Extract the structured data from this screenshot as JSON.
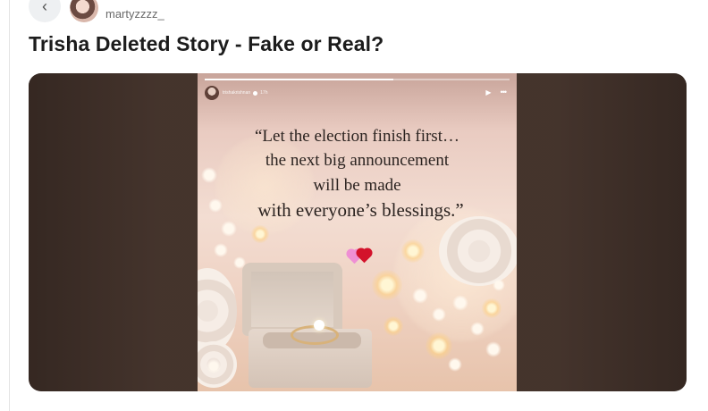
{
  "header": {
    "back_icon": "chevron-left-icon",
    "username": "martyzzzz_"
  },
  "post": {
    "title": "Trisha Deleted Story - Fake or Real?"
  },
  "story": {
    "progress": 0.62,
    "user_handle": "trishakrishnan",
    "time": "17h",
    "quote_lines": [
      "“Let the election finish first…",
      "the next big announcement",
      "will be made",
      "with everyone’s blessings.”"
    ],
    "emoji_icon": "hearts-icon",
    "play_icon": "play-icon",
    "more_icon": "more-options-icon"
  },
  "colors": {
    "frame_background": "#3e2f28",
    "title_text": "#1c1c1c",
    "username_text": "#6a6a6a"
  }
}
